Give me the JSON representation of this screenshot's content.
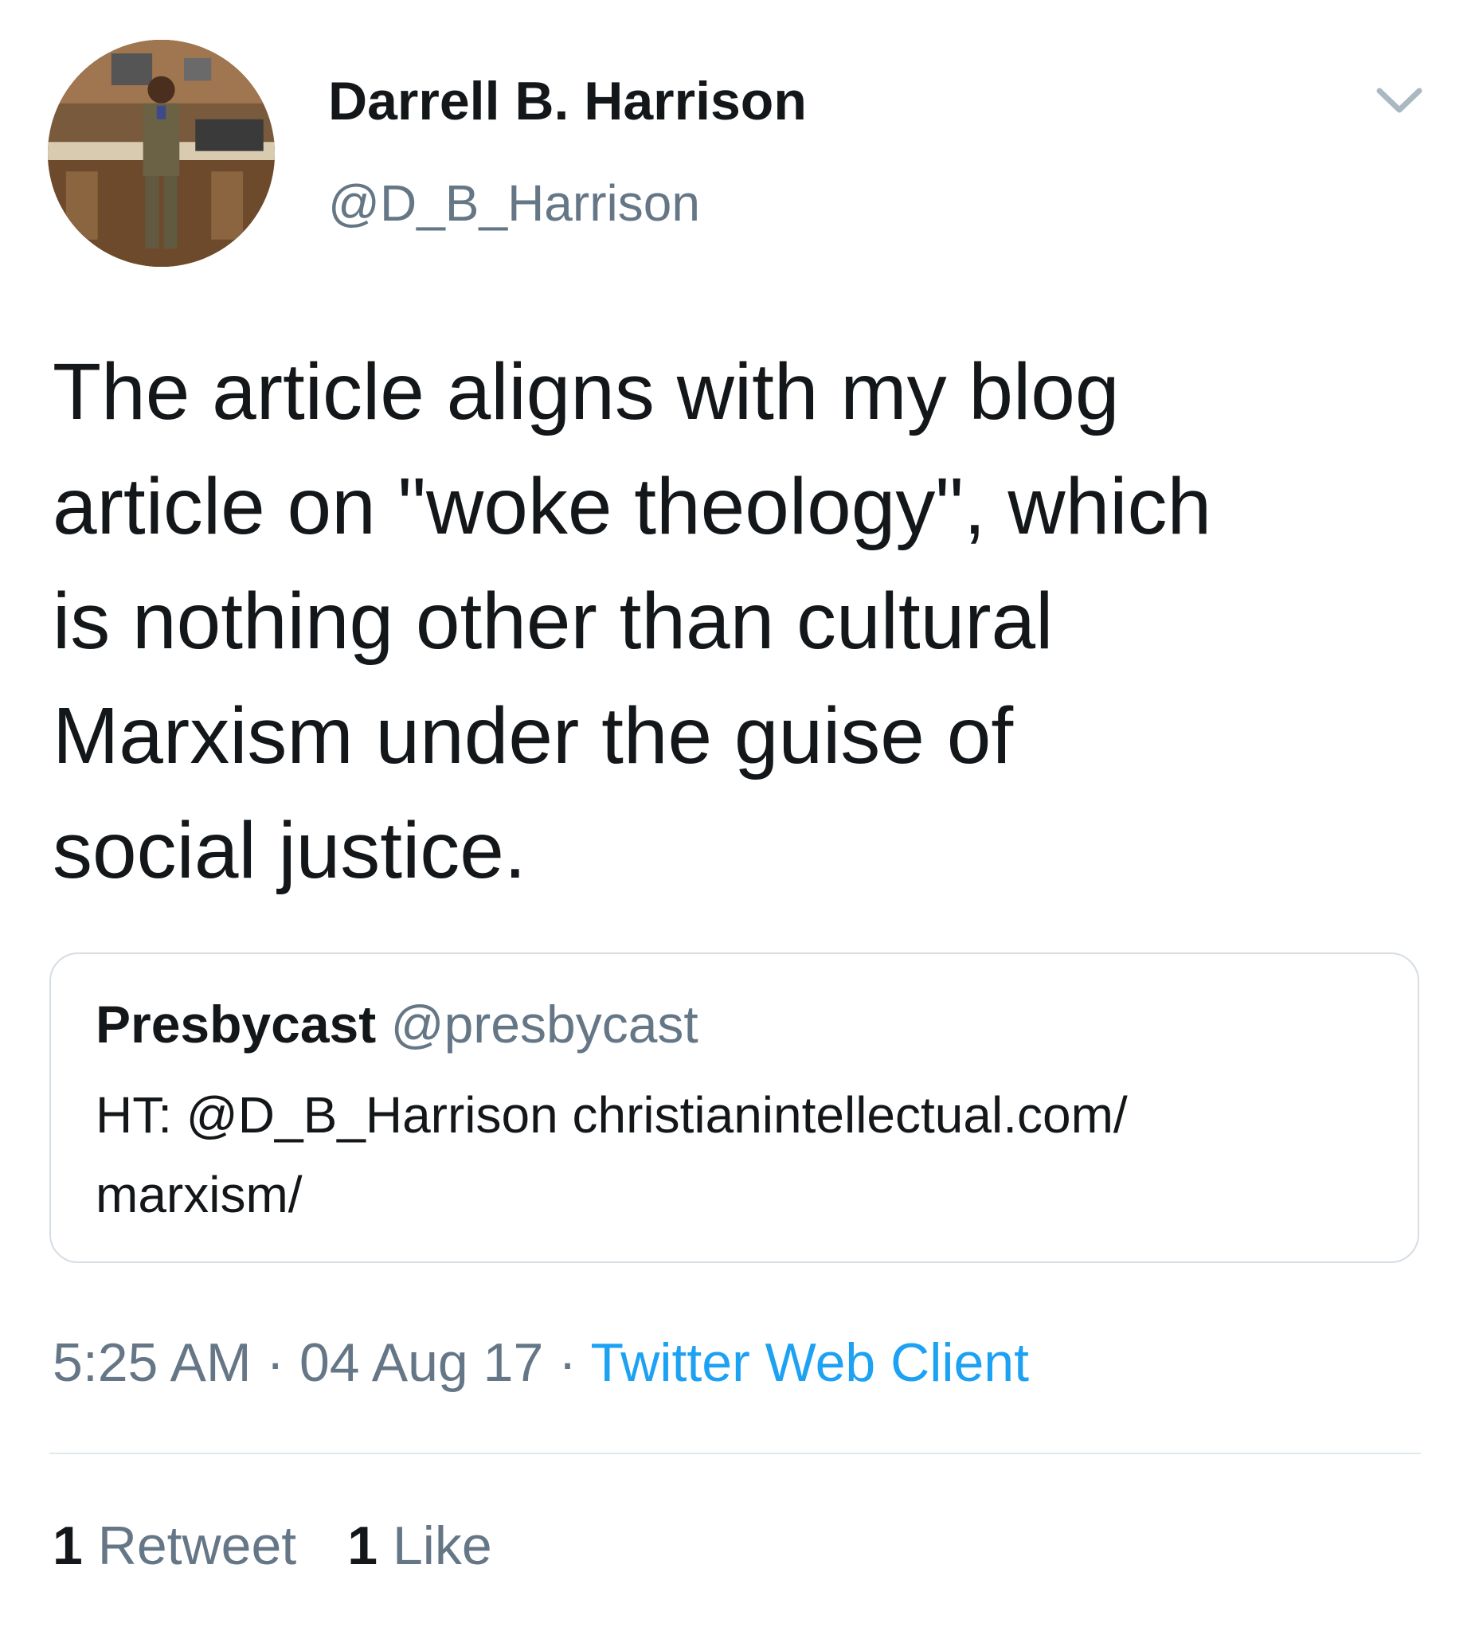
{
  "author": {
    "display_name": "Darrell B. Harrison",
    "handle": "@D_B_Harrison",
    "avatar_icon": "avatar-photo"
  },
  "tweet": {
    "text_lines": [
      "The article aligns with my blog",
      "article on \"woke theology\", which",
      "is nothing other than cultural",
      "Marxism under the guise of",
      "social justice."
    ]
  },
  "quoted_tweet": {
    "display_name": "Presbycast",
    "handle": "@presbycast",
    "body_lines": [
      "HT: @D_B_Harrison  christianintellectual.com/",
      "marxism/"
    ]
  },
  "meta": {
    "time": "5:25 AM",
    "date": "04 Aug 17",
    "source": "Twitter Web Client",
    "separator": "·"
  },
  "stats": {
    "retweet_count": "1",
    "retweet_label": "Retweet",
    "like_count": "1",
    "like_label": "Like"
  },
  "colors": {
    "text": "#14171a",
    "secondary": "#657786",
    "link": "#1da1f2",
    "border": "#d6dde3",
    "divider": "#e1e8ed"
  },
  "icons": {
    "menu": "chevron-down-icon"
  }
}
